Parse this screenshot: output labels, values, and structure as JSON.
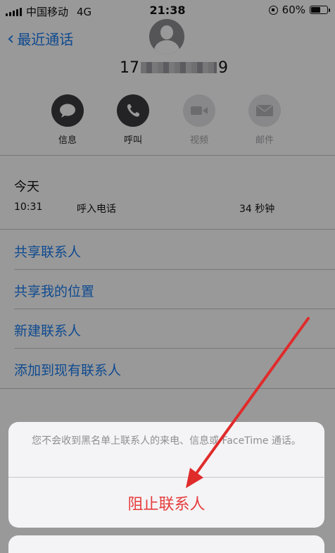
{
  "status_bar": {
    "carrier": "中国移动",
    "network": "4G",
    "time": "21:38",
    "battery": "60%",
    "battery_level": 0.6
  },
  "nav": {
    "back_label": "最近通话"
  },
  "contact": {
    "number_start": "17",
    "number_end": "9"
  },
  "actions": [
    {
      "label": "信息",
      "icon": "message-icon",
      "enabled": true
    },
    {
      "label": "呼叫",
      "icon": "phone-icon",
      "enabled": true
    },
    {
      "label": "视频",
      "icon": "video-icon",
      "enabled": false
    },
    {
      "label": "邮件",
      "icon": "mail-icon",
      "enabled": false
    }
  ],
  "recents": {
    "day": "今天",
    "time": "10:31",
    "type": "呼入电话",
    "duration": "34 秒钟"
  },
  "menu": [
    "共享联系人",
    "共享我的位置",
    "新建联系人",
    "添加到现有联系人"
  ],
  "sheet": {
    "message": "您不会收到黑名单上联系人的来电、信息或 FaceTime 通话。",
    "block_label": "阻止联系人"
  },
  "colors": {
    "accent": "#1a7cf0",
    "destructive": "#e63b3b",
    "annotation_arrow": "#e02b2b"
  }
}
